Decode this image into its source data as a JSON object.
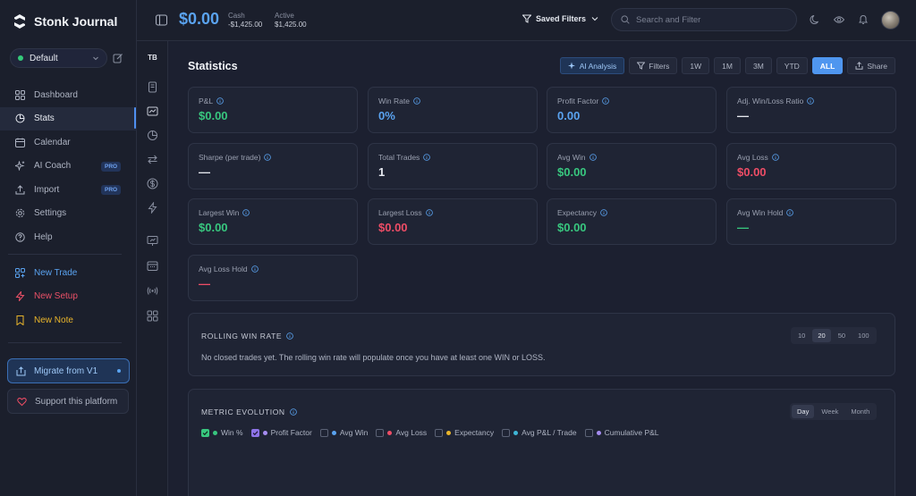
{
  "brand": {
    "name": "Stonk Journal"
  },
  "workspace": {
    "label": "Default",
    "status_color": "#34c97a"
  },
  "sidebar": {
    "items": [
      {
        "label": "Dashboard",
        "icon": "grid-icon"
      },
      {
        "label": "Stats",
        "icon": "pie-chart-icon",
        "active": true
      },
      {
        "label": "Calendar",
        "icon": "calendar-icon"
      },
      {
        "label": "AI Coach",
        "icon": "sparkle-icon",
        "badge": "PRO"
      },
      {
        "label": "Import",
        "icon": "upload-icon",
        "badge": "PRO"
      },
      {
        "label": "Settings",
        "icon": "gear-icon"
      },
      {
        "label": "Help",
        "icon": "help-icon"
      }
    ],
    "quick_actions": [
      {
        "label": "New Trade",
        "color": "#5aa3f0"
      },
      {
        "label": "New Setup",
        "color": "#ea5067"
      },
      {
        "label": "New Note",
        "color": "#e9b52b"
      }
    ],
    "migrate_label": "Migrate from V1",
    "support_label": "Support this platform"
  },
  "rail": {
    "label": "TB"
  },
  "header": {
    "balance": "$0.00",
    "cash_label": "Cash",
    "cash_value": "-$1,425.00",
    "active_label": "Active",
    "active_value": "$1,425.00",
    "saved_filters": "Saved Filters",
    "search_placeholder": "Search and Filter"
  },
  "page": {
    "title": "Statistics",
    "toolbar": {
      "ai_label": "AI Analysis",
      "filters_label": "Filters",
      "ranges": [
        "1W",
        "1M",
        "3M",
        "YTD",
        "ALL"
      ],
      "active_range": "ALL",
      "share_label": "Share"
    }
  },
  "stats": [
    {
      "label": "P&L",
      "value": "$0.00",
      "tone": "green"
    },
    {
      "label": "Win Rate",
      "value": "0%",
      "tone": "blue"
    },
    {
      "label": "Profit Factor",
      "value": "0.00",
      "tone": "blue"
    },
    {
      "label": "Adj. Win/Loss Ratio",
      "value": "—",
      "tone": "white"
    },
    {
      "label": "Sharpe (per trade)",
      "value": "—",
      "tone": "white"
    },
    {
      "label": "Total Trades",
      "value": "1",
      "tone": "white"
    },
    {
      "label": "Avg Win",
      "value": "$0.00",
      "tone": "green"
    },
    {
      "label": "Avg Loss",
      "value": "$0.00",
      "tone": "red"
    },
    {
      "label": "Largest Win",
      "value": "$0.00",
      "tone": "green"
    },
    {
      "label": "Largest Loss",
      "value": "$0.00",
      "tone": "red"
    },
    {
      "label": "Expectancy",
      "value": "$0.00",
      "tone": "green"
    },
    {
      "label": "Avg Win Hold",
      "value": "—",
      "tone": "green"
    },
    {
      "label": "Avg Loss Hold",
      "value": "—",
      "tone": "red"
    }
  ],
  "rolling": {
    "title": "ROLLING WIN RATE",
    "windows": [
      "10",
      "20",
      "50",
      "100"
    ],
    "active_window": "20",
    "empty_message": "No closed trades yet. The rolling win rate will populate once you have at least one WIN or LOSS."
  },
  "evolution": {
    "title": "METRIC EVOLUTION",
    "periods": [
      "Day",
      "Week",
      "Month"
    ],
    "active_period": "Day",
    "metrics": [
      {
        "label": "Win %",
        "checked": true,
        "dot": "#38c77f",
        "check_color": "#38c77f"
      },
      {
        "label": "Profit Factor",
        "checked": true,
        "dot": "#a58cf0",
        "check_color": "#8e74e8"
      },
      {
        "label": "Avg Win",
        "checked": false,
        "dot": "#5aa3f0"
      },
      {
        "label": "Avg Loss",
        "checked": false,
        "dot": "#ee4d66"
      },
      {
        "label": "Expectancy",
        "checked": false,
        "dot": "#e9b52b"
      },
      {
        "label": "Avg P&L / Trade",
        "checked": false,
        "dot": "#3fb6d6"
      },
      {
        "label": "Cumulative P&L",
        "checked": false,
        "dot": "#a58cf0"
      }
    ]
  }
}
